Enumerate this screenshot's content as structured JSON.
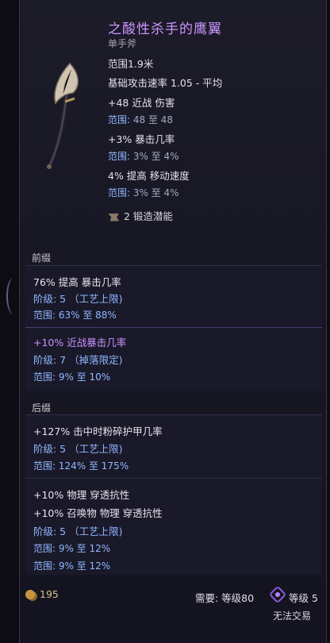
{
  "item": {
    "name": "之酸性杀手的鹰翼",
    "type": "单手斧",
    "range": "范围1.9米",
    "attack_speed": "基础攻击速率 1.05 - 平均",
    "implicits": [
      {
        "text": "+48 近战 伤害",
        "range_label": "范围:",
        "range_value": "48 至 48"
      },
      {
        "text": "+3% 暴击几率",
        "range_label": "范围:",
        "range_value": "3% 至 4%"
      },
      {
        "text": "4% 提高 移动速度",
        "range_label": "范围:",
        "range_value": "3% 至 4%"
      }
    ],
    "forging_potential": "2 锻造潜能"
  },
  "prefix": {
    "label": "前缀",
    "mods": [
      {
        "text": "76% 提高 暴击几率",
        "tier": "阶级: 5 （工艺上限)",
        "range": "范围: 63% 至 88%"
      },
      {
        "text": "+10% 近战暴击几率",
        "tier": "阶级: 7 （掉落限定)",
        "range": "范围: 9% 至 10%"
      }
    ]
  },
  "suffix": {
    "label": "后缀",
    "mods": [
      {
        "text": "+127% 击中时粉碎护甲几率",
        "tier": "阶级: 5 （工艺上限)",
        "range": "范围: 124% 至 175%"
      },
      {
        "text1": "+10% 物理 穿透抗性",
        "text2": "+10% 召唤物 物理 穿透抗性",
        "tier": "阶级: 5 （工艺上限)",
        "range1": "范围: 9% 至 12%",
        "range2": "范围: 9% 至 12%"
      }
    ]
  },
  "footer": {
    "gold": "195",
    "requirement": "需要: 等级80",
    "rank": "等级 5",
    "trade": "无法交易"
  }
}
